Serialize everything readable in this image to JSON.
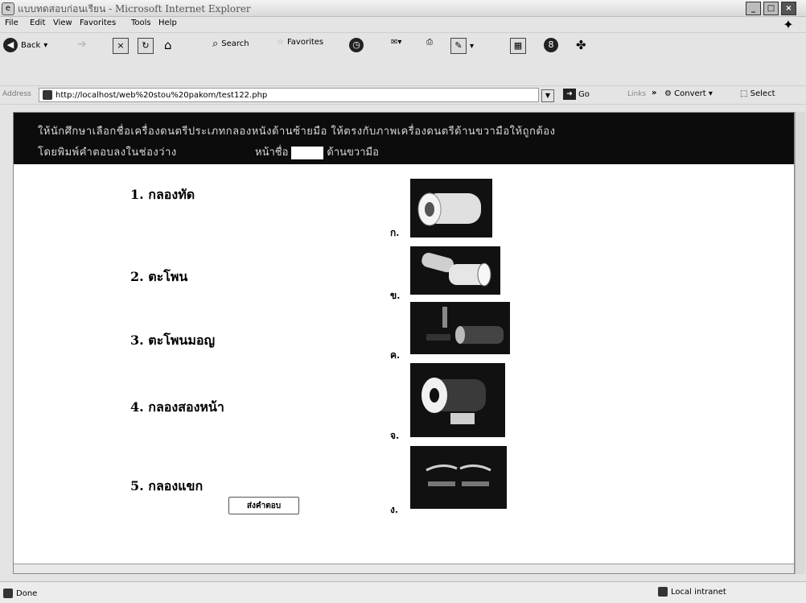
{
  "window": {
    "title": "แบบทดสอบก่อนเรียน - Microsoft Internet Explorer",
    "controls": [
      "_",
      "□",
      "×"
    ]
  },
  "menu": [
    "File",
    "Edit",
    "View",
    "Favorites",
    "Tools",
    "Help"
  ],
  "toolbar": {
    "back": "Back",
    "search": "Search",
    "favorites": "Favorites"
  },
  "address": {
    "label": "Address",
    "url": "http://localhost/web%20stou%20pakom/test122.php",
    "go": "Go",
    "links": "Links",
    "chevron": "»",
    "convert": "Convert",
    "select": "Select"
  },
  "page": {
    "instruction_line1": "ให้นักศึกษาเลือกชื่อเครื่องดนตรีประเภทกลองหนังด้านซ้ายมือ ให้ตรงกับภาพเครื่องดนตรีด้านขวามือให้ถูกต้อง",
    "instruction_line2a": "โดยพิมพ์คำตอบลงในช่องว่าง",
    "instruction_line2b": "หน้าชื่อ",
    "instruction_line2c": "ด้านขวามือ",
    "items": [
      {
        "number": "1.",
        "name": "กลองทัด"
      },
      {
        "number": "2.",
        "name": "ตะโพน"
      },
      {
        "number": "3.",
        "name": "ตะโพนมอญ"
      },
      {
        "number": "4.",
        "name": "กลองสองหน้า"
      },
      {
        "number": "5.",
        "name": "กลองแขก"
      }
    ],
    "choices": [
      "ก.",
      "ข.",
      "ค.",
      "จ.",
      "ง."
    ],
    "submit_label": "ส่งคำตอบ"
  },
  "status": {
    "left": "Done",
    "zone": "Local intranet"
  }
}
